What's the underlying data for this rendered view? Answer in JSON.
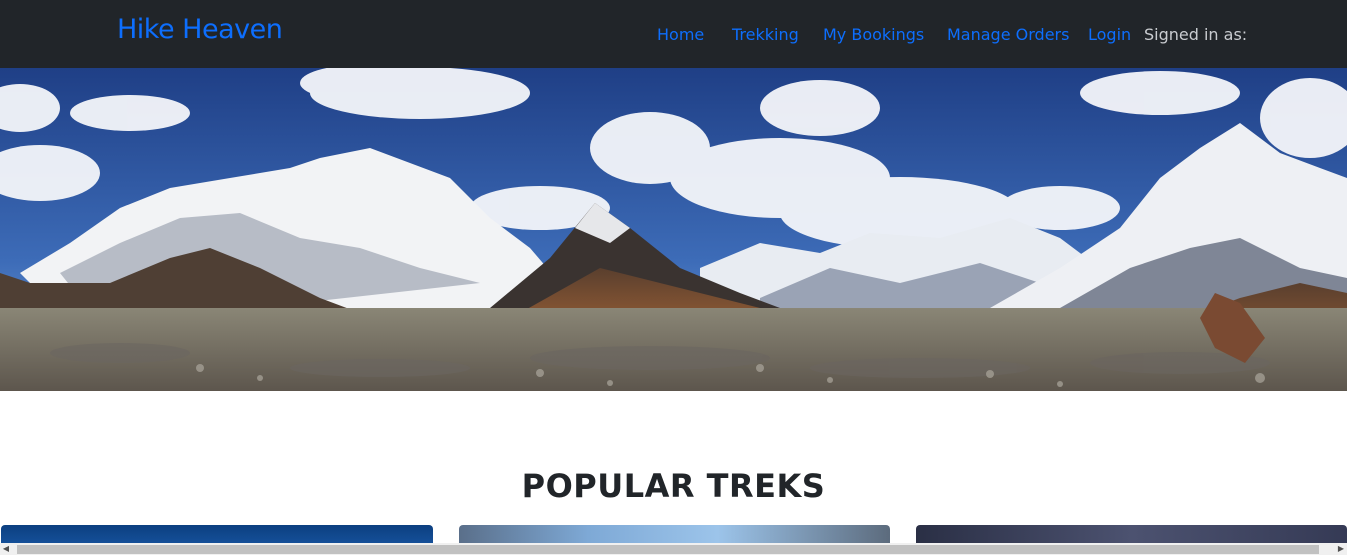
{
  "navbar": {
    "brand": "Hike Heaven",
    "links": [
      {
        "label": "Home"
      },
      {
        "label": "Trekking"
      },
      {
        "label": "My Bookings"
      },
      {
        "label": "Manage Orders"
      },
      {
        "label": "Login"
      }
    ],
    "signed_in_label": "Signed in as:"
  },
  "hero": {
    "image_name": "mountain-panorama"
  },
  "main": {
    "section_title": "POPULAR TREKS",
    "cards": [
      {
        "image_name": "trek-card-image"
      },
      {
        "image_name": "trek-card-image"
      },
      {
        "image_name": "trek-card-image"
      }
    ]
  },
  "scrollbar": {
    "left_icon": "triangle-left-icon",
    "right_icon": "triangle-right-icon"
  },
  "colors": {
    "navbar_bg": "#212529",
    "link": "#0d6efd",
    "title": "#212529"
  }
}
